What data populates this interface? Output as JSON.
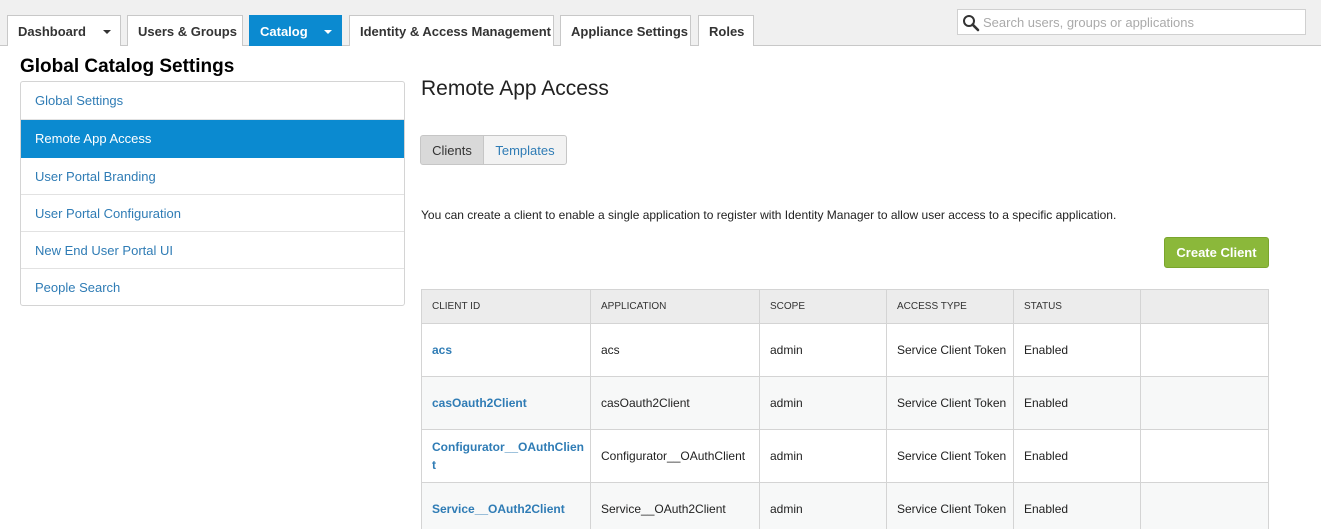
{
  "nav": {
    "tabs": [
      {
        "label": "Dashboard",
        "has_dropdown": true
      },
      {
        "label": "Users & Groups",
        "has_dropdown": false
      },
      {
        "label": "Catalog",
        "has_dropdown": true,
        "active": true
      },
      {
        "label": "Identity & Access Management",
        "has_dropdown": false
      },
      {
        "label": "Appliance Settings",
        "has_dropdown": false
      },
      {
        "label": "Roles",
        "has_dropdown": false
      }
    ],
    "search_placeholder": "Search users, groups or applications"
  },
  "page_title": "Global Catalog Settings",
  "sidebar": {
    "items": [
      {
        "label": "Global Settings"
      },
      {
        "label": "Remote App Access",
        "active": true
      },
      {
        "label": "User Portal Branding"
      },
      {
        "label": "User Portal Configuration"
      },
      {
        "label": "New End User Portal UI"
      },
      {
        "label": "People Search"
      }
    ]
  },
  "main": {
    "title": "Remote App Access",
    "segments": {
      "clients": "Clients",
      "templates": "Templates",
      "selected": "Clients"
    },
    "description": "You can create a client to enable a single application to register with Identity Manager to allow user access to a specific application.",
    "create_button": "Create Client"
  },
  "table": {
    "headers": [
      "CLIENT ID",
      "APPLICATION",
      "SCOPE",
      "ACCESS TYPE",
      "STATUS",
      ""
    ],
    "rows": [
      {
        "client_id": "acs",
        "application": "acs",
        "scope": "admin",
        "access_type": "Service Client Token",
        "status": "Enabled"
      },
      {
        "client_id": "casOauth2Client",
        "application": "casOauth2Client",
        "scope": "admin",
        "access_type": "Service Client Token",
        "status": "Enabled"
      },
      {
        "client_id": "Configurator__OAuthClient",
        "application": "Configurator__OAuthClient",
        "scope": "admin",
        "access_type": "Service Client Token",
        "status": "Enabled"
      },
      {
        "client_id": "Service__OAuth2Client",
        "application": "Service__OAuth2Client",
        "scope": "admin",
        "access_type": "Service Client Token",
        "status": "Enabled"
      }
    ]
  },
  "colors": {
    "accent": "#0b8ad0",
    "link": "#2f7cb5",
    "create_button": "#8bb83a"
  }
}
